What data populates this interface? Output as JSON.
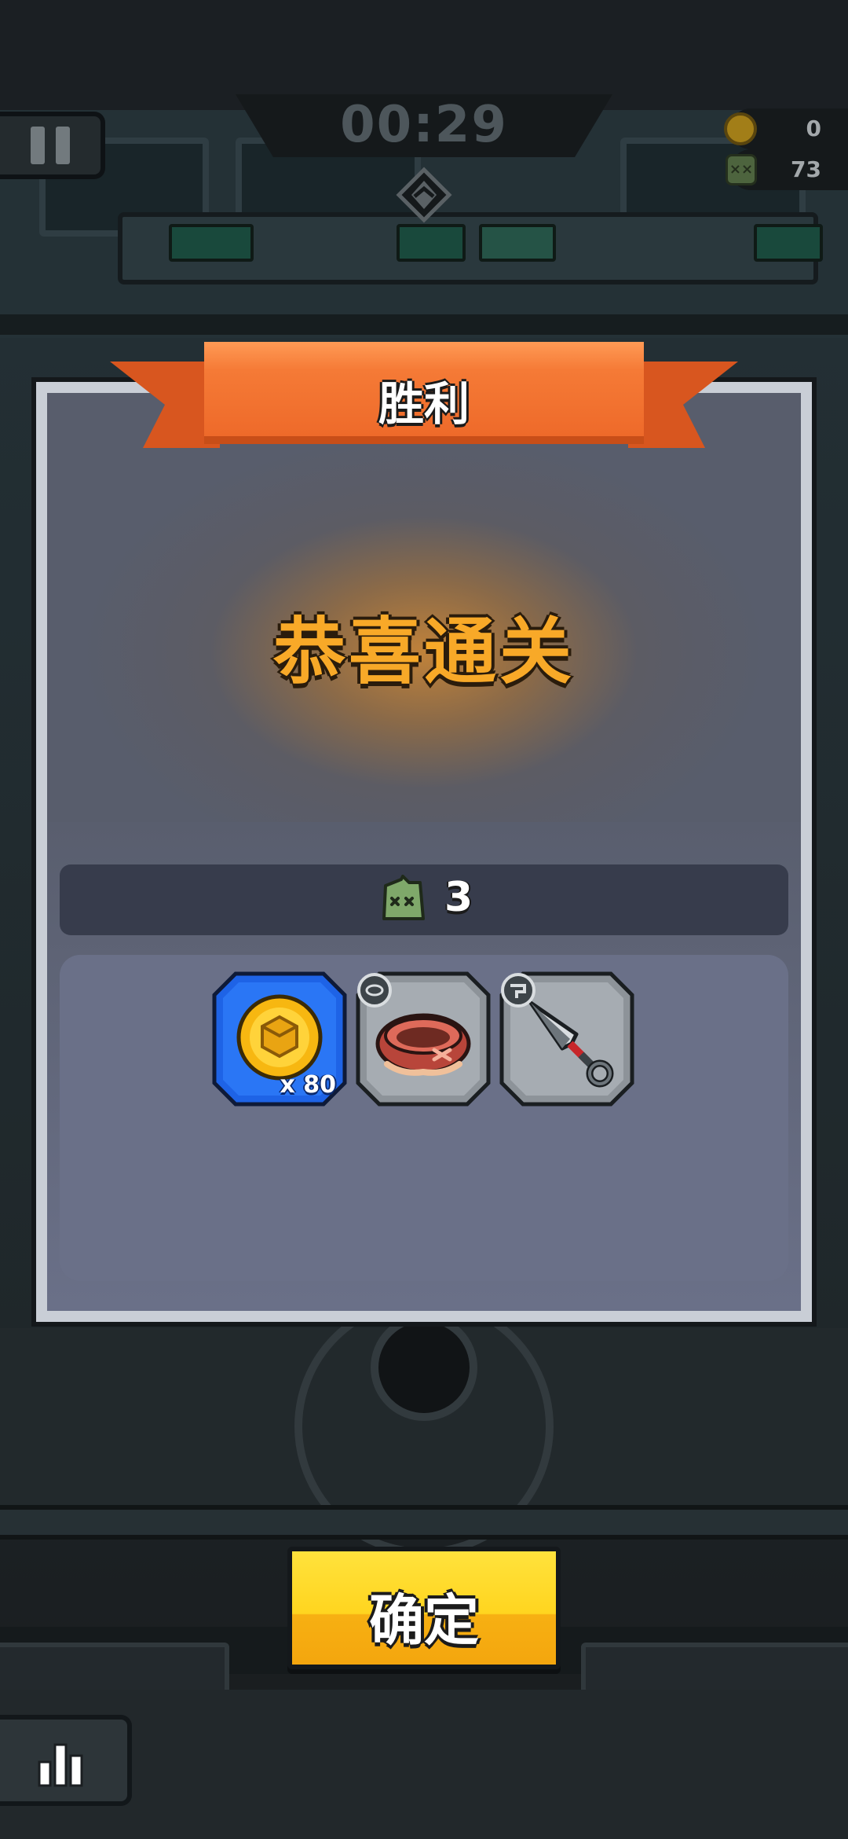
{
  "hud": {
    "timer": "00:29",
    "coins": "0",
    "kills_total": "73"
  },
  "result": {
    "title": "胜利",
    "headline": "恭喜通关",
    "kill_count": "3"
  },
  "rewards": [
    {
      "name": "coin",
      "icon": "coin-icon",
      "quantity": "x 80",
      "rarity_color": "#1e63e6"
    },
    {
      "name": "collar",
      "icon": "collar-icon",
      "quantity": "",
      "rarity_color": "#8d9399"
    },
    {
      "name": "kunai",
      "icon": "kunai-icon",
      "quantity": "",
      "rarity_color": "#8d9399"
    }
  ],
  "buttons": {
    "confirm": "确定"
  },
  "colors": {
    "ribbon": "#f57a36",
    "headline": "#f8a928",
    "confirm": "#ffd51f",
    "rare_blue": "#1e63e6"
  }
}
